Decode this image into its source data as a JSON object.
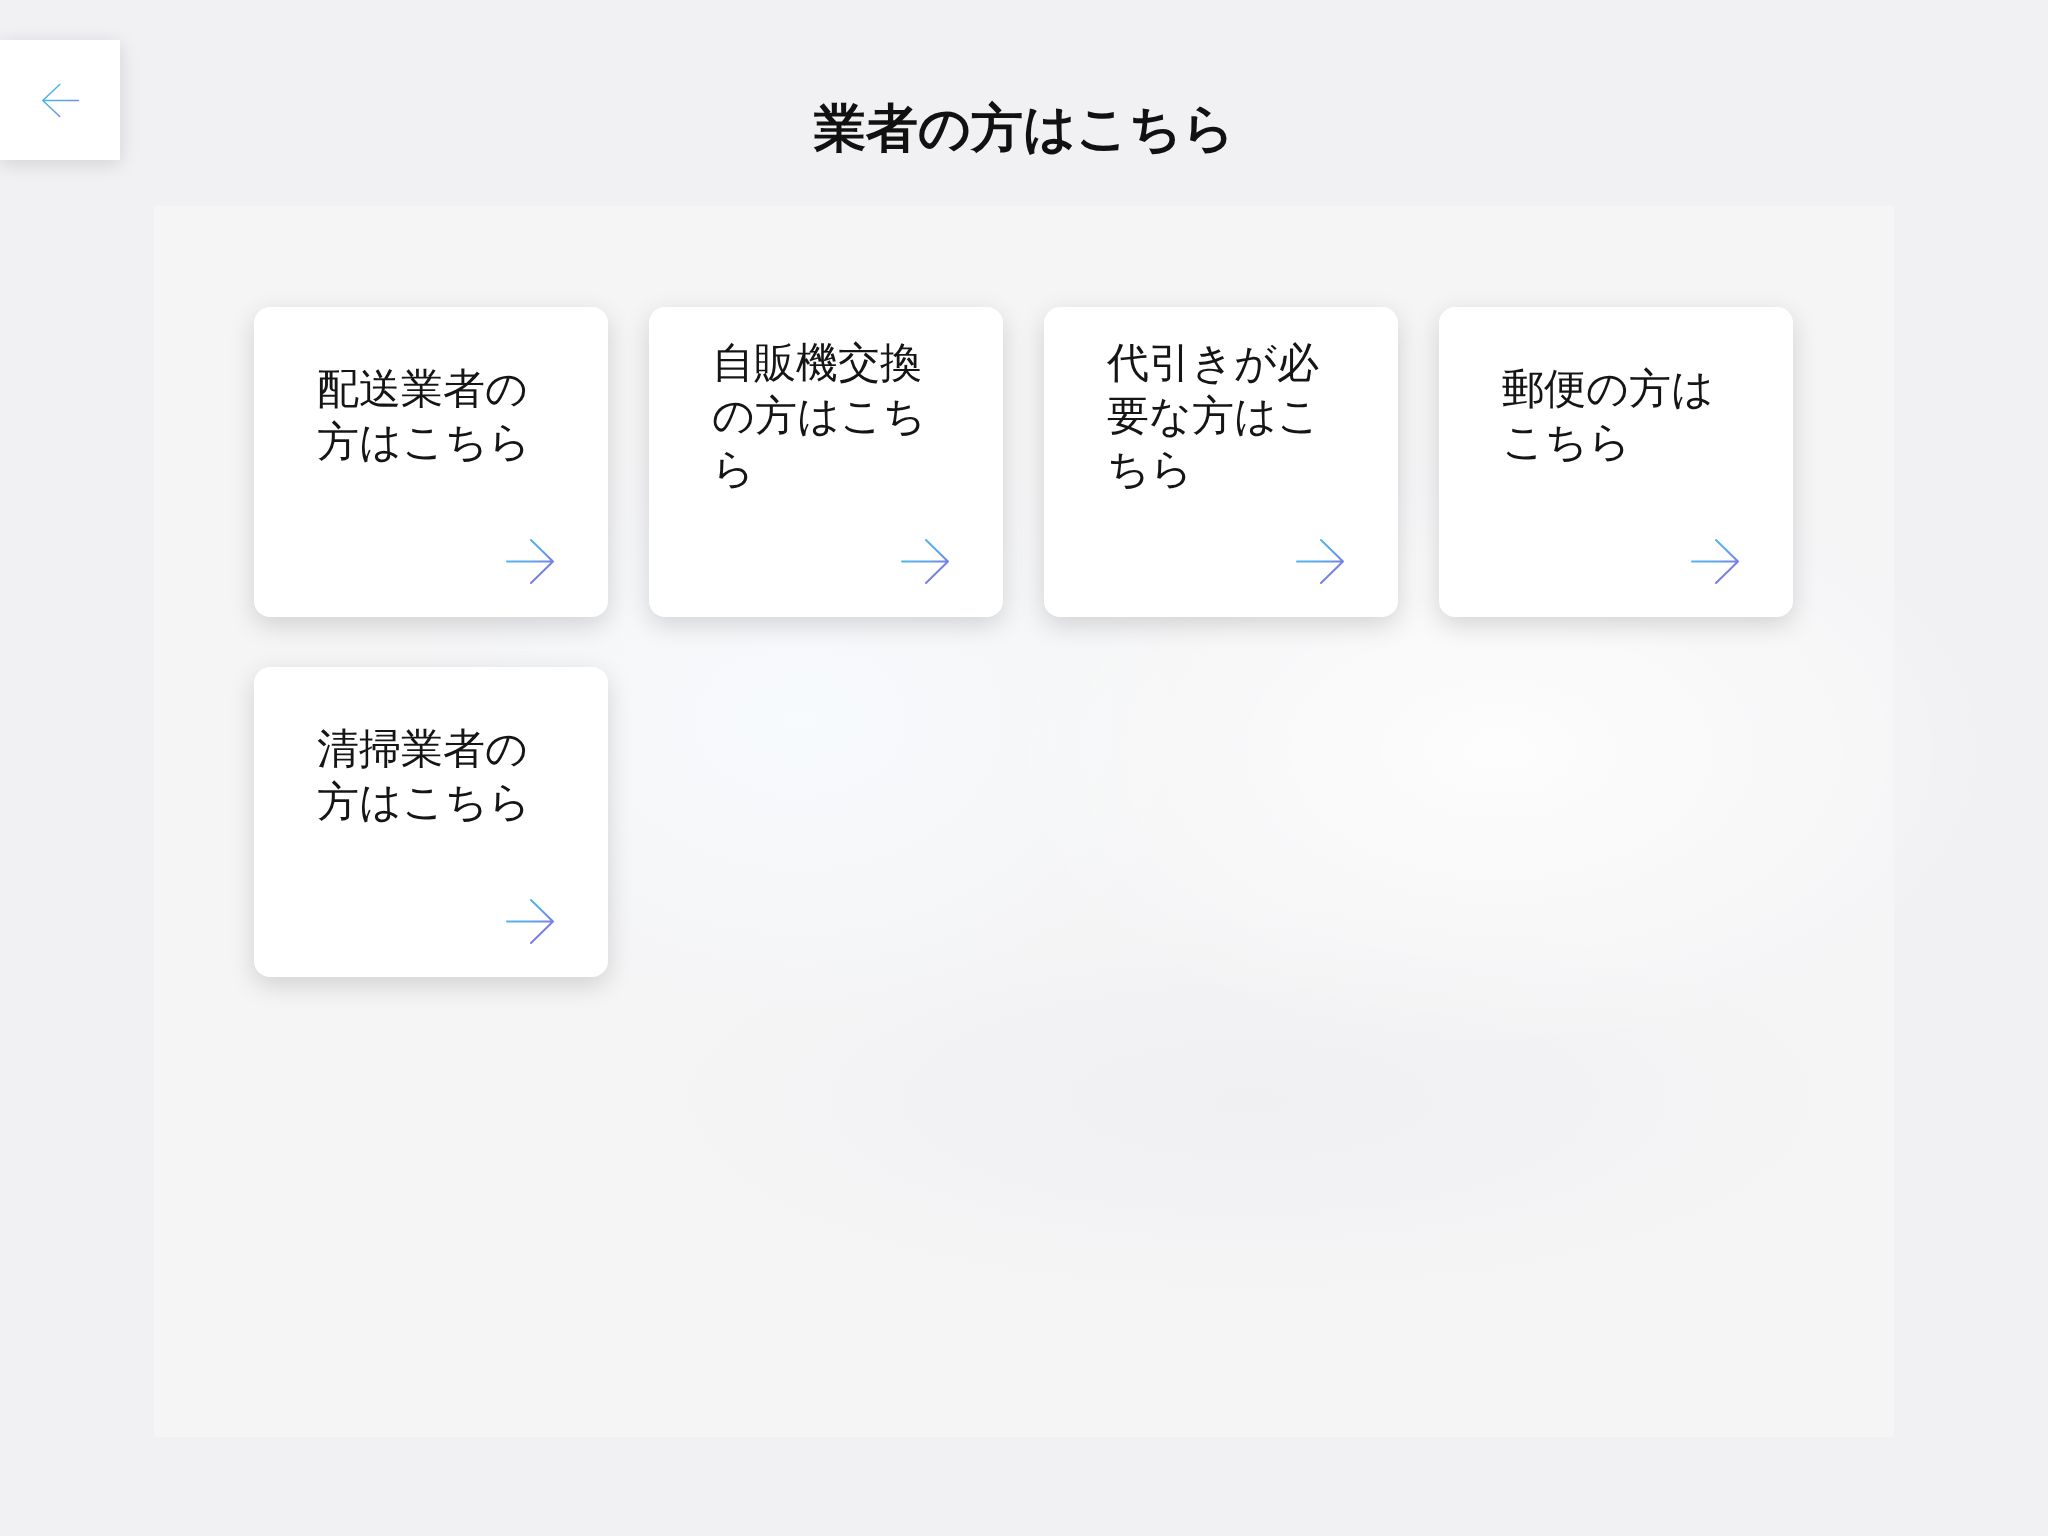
{
  "title": "業者の方はこちら",
  "cards": [
    {
      "label": "配送業者の方はこちら"
    },
    {
      "label": "自販機交換の方はこちら"
    },
    {
      "label": "代引きが必要な方はこちら"
    },
    {
      "label": "郵便の方はこちら"
    },
    {
      "label": "清掃業者の方はこちら"
    }
  ]
}
